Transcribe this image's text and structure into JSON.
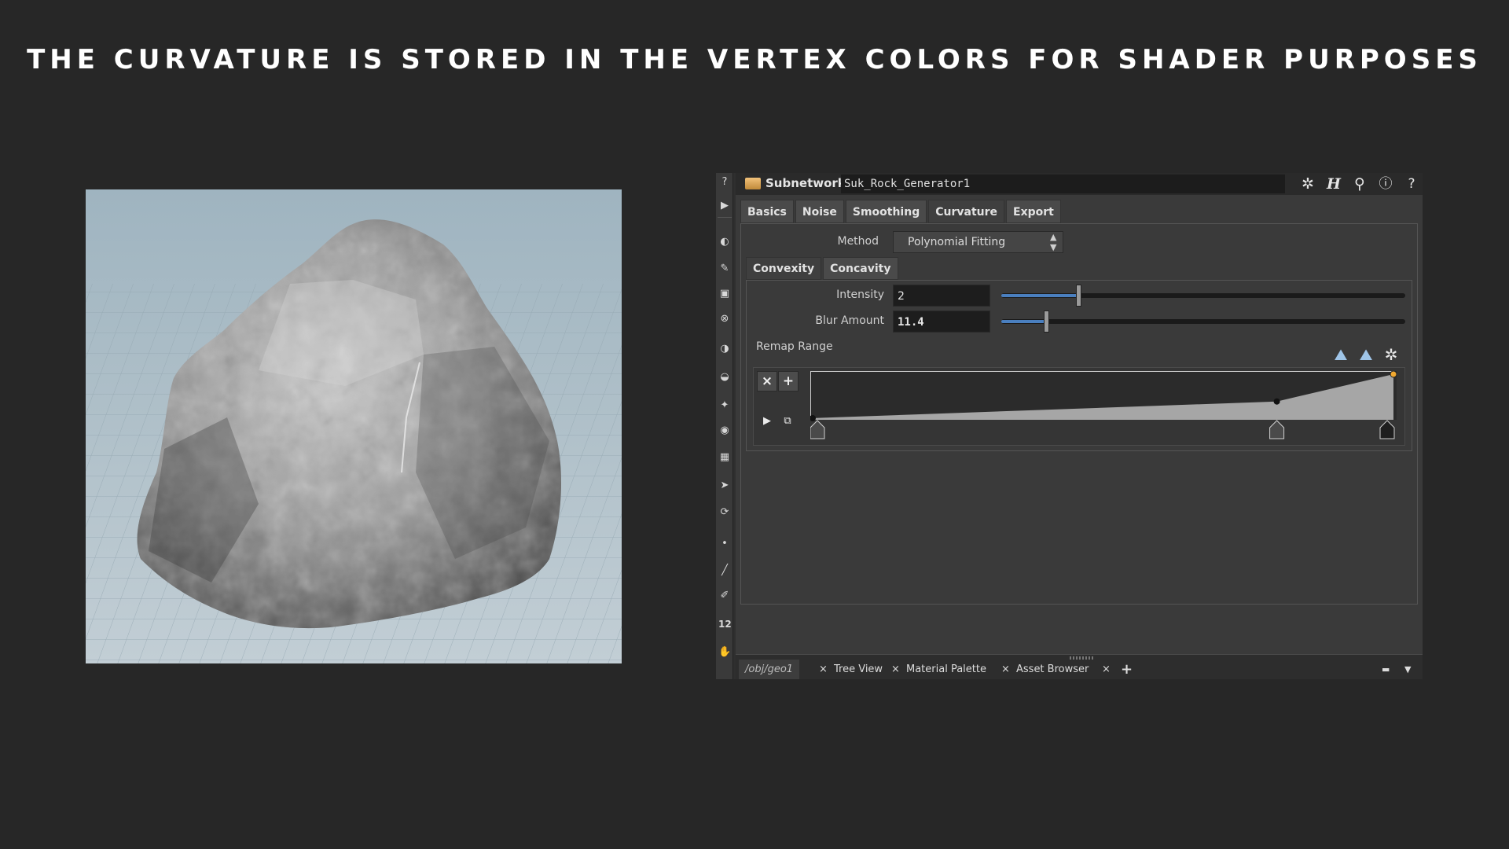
{
  "headline": "THE CURVATURE IS STORED IN THE VERTEX COLORS FOR SHADER PURPOSES",
  "viewport": {
    "subject": "rock"
  },
  "parameter_panel": {
    "node_type": "Subnetwork",
    "node_name": "Suk_Rock_Generator1",
    "title_icons": [
      "gear-icon",
      "houdini-h-icon",
      "search-icon",
      "info-icon",
      "help-icon"
    ],
    "tabs": [
      {
        "label": "Basics",
        "active": false
      },
      {
        "label": "Noise",
        "active": false
      },
      {
        "label": "Smoothing",
        "active": false
      },
      {
        "label": "Curvature",
        "active": true
      },
      {
        "label": "Export",
        "active": false
      }
    ],
    "method": {
      "label": "Method",
      "value": "Polynomial Fitting"
    },
    "subtabs": [
      {
        "label": "Convexity",
        "active": true
      },
      {
        "label": "Concavity",
        "active": false
      }
    ],
    "intensity": {
      "label": "Intensity",
      "value": "2",
      "slider_fraction": 0.19
    },
    "blur_amount": {
      "label": "Blur Amount",
      "value": "11.4",
      "slider_fraction": 0.11
    },
    "remap": {
      "label": "Remap Range",
      "keys": [
        {
          "pos": 0.0,
          "value": 0.0
        },
        {
          "pos": 0.8,
          "value": 0.38
        },
        {
          "pos": 1.0,
          "value": 1.0
        }
      ]
    },
    "bottom_tabs": [
      {
        "label": "/obj/geo1"
      },
      {
        "label": "Tree View"
      },
      {
        "label": "Material Palette"
      },
      {
        "label": "Asset Browser"
      }
    ],
    "add_tab": "+",
    "toolstrip_number": "12"
  }
}
